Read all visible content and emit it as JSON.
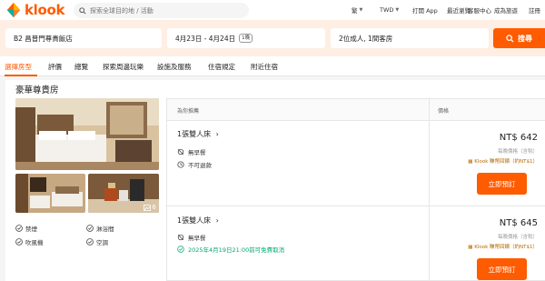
{
  "header": {
    "brand": "klook",
    "search_placeholder": "探索全球目的地 / 活動",
    "nav": [
      "繁",
      "TWD",
      "打開 App",
      "最近瀏覽",
      "客服中心",
      "成為旅遊",
      "註冊"
    ]
  },
  "search_bar": {
    "destination": "B2 昌普門尊貴飯店",
    "dates": "4月23日 - 4月24日",
    "nights": "1晚",
    "guests": "2位成人, 1間客房",
    "search_button": "搜尋"
  },
  "tabs": [
    "選擇房型",
    "評價",
    "總覽",
    "探索周邊玩樂",
    "設施及服務",
    "住宿規定",
    "附近住宿"
  ],
  "room": {
    "title": "豪華尊貴房",
    "photo_count": "6",
    "amenities": [
      "禁煙",
      "淋浴間",
      "吹風機",
      "空調"
    ]
  },
  "table": {
    "col_recommend": "為你推薦",
    "col_price": "價格",
    "offers": [
      {
        "name": "1張雙人床",
        "features": [
          "無早餐",
          "不可退款"
        ],
        "price": "NT$ 642",
        "price_note": "每晚價格（含稅）",
        "coins": "Klook 賺幣回饋（約NT$1）",
        "book": "立即預訂"
      },
      {
        "name": "1張雙人床",
        "features": [
          "無早餐",
          "2025年4月19日21:00前可免費取消"
        ],
        "price": "NT$ 645",
        "price_note": "每晚價格（含稅）",
        "coins": "Klook 賺幣回饋（約NT$1）",
        "book": "立即預訂"
      }
    ]
  },
  "colors": {
    "accent": "#ff5b00",
    "green": "#00a870",
    "search_bg": "#ffeee3"
  }
}
